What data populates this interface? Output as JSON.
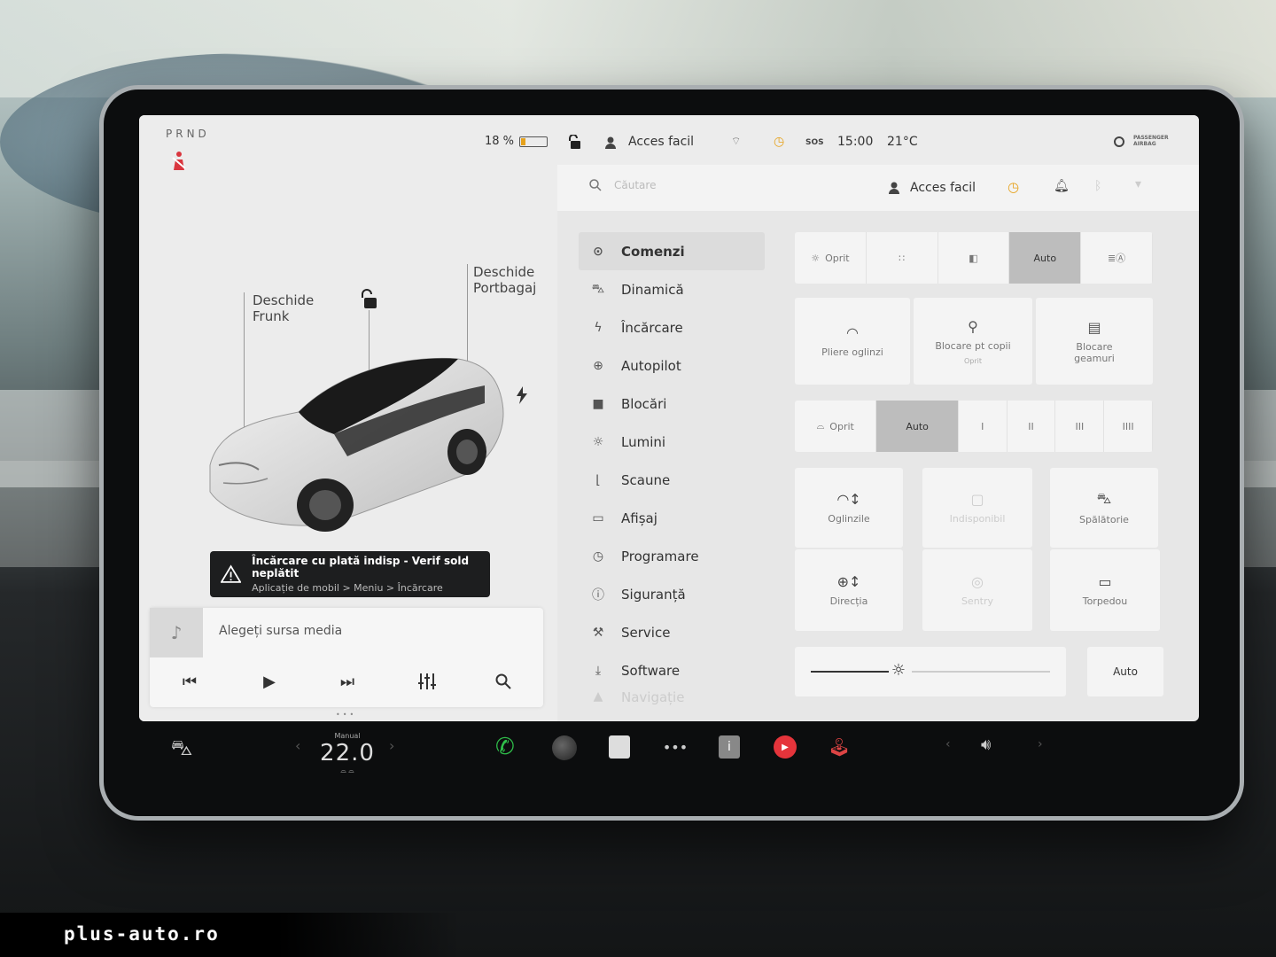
{
  "left": {
    "gear": "PRND",
    "battery_percent_text": "18 %",
    "battery_level": 0.18,
    "frunk_line1": "Deschide",
    "frunk_line2": "Frunk",
    "trunk_line1": "Deschide",
    "trunk_line2": "Portbagaj",
    "alert_title": "Încărcare cu plată indisp - Verif sold neplătit",
    "alert_sub": "Aplicație de mobil > Meniu > Încărcare",
    "media_source": "Alegeți sursa media"
  },
  "topbar": {
    "profile": "Acces facil",
    "time": "15:00",
    "temp": "21°C",
    "sos": "SOS",
    "airbag": "PASSENGER AIRBAG"
  },
  "search": {
    "placeholder": "Căutare",
    "profile": "Acces facil"
  },
  "menu": [
    {
      "label": "Comenzi",
      "icon": "toggle-icon"
    },
    {
      "label": "Dinamică",
      "icon": "car-icon"
    },
    {
      "label": "Încărcare",
      "icon": "bolt-icon"
    },
    {
      "label": "Autopilot",
      "icon": "steering-icon"
    },
    {
      "label": "Blocări",
      "icon": "lock-icon"
    },
    {
      "label": "Lumini",
      "icon": "sun-icon"
    },
    {
      "label": "Scaune",
      "icon": "seat-icon"
    },
    {
      "label": "Afișaj",
      "icon": "display-icon"
    },
    {
      "label": "Programare",
      "icon": "clock-icon"
    },
    {
      "label": "Siguranță",
      "icon": "info-icon"
    },
    {
      "label": "Service",
      "icon": "wrench-icon"
    },
    {
      "label": "Software",
      "icon": "download-icon"
    },
    {
      "label": "Navigație",
      "icon": "nav-icon"
    }
  ],
  "controls": {
    "lights": [
      "Oprit",
      "",
      "",
      "Auto",
      ""
    ],
    "lights_selected": 3,
    "fold_mirrors": "Pliere oglinzi",
    "child_lock": "Blocare pt copii",
    "child_lock_sub": "Oprit",
    "window_lock": "Blocare geamuri",
    "wipers": [
      "Oprit",
      "Auto",
      "I",
      "II",
      "III",
      "IIII"
    ],
    "wipers_selected": 1,
    "mirrors": "Oglinzile",
    "unavailable": "Indisponibil",
    "car_wash": "Spălătorie",
    "steering": "Direcția",
    "sentry": "Sentry",
    "glovebox": "Torpedou",
    "brightness_auto": "Auto",
    "brightness_level": 0.37
  },
  "dock": {
    "temp_mode": "Manual",
    "temp_value": "22.0"
  },
  "watermark": "plus-auto.ro",
  "colors": {
    "accent_orange": "#e6a21c",
    "alert_bg": "#1d1e1f",
    "phone_green": "#2fbf4a",
    "music_red": "#e5343b"
  }
}
